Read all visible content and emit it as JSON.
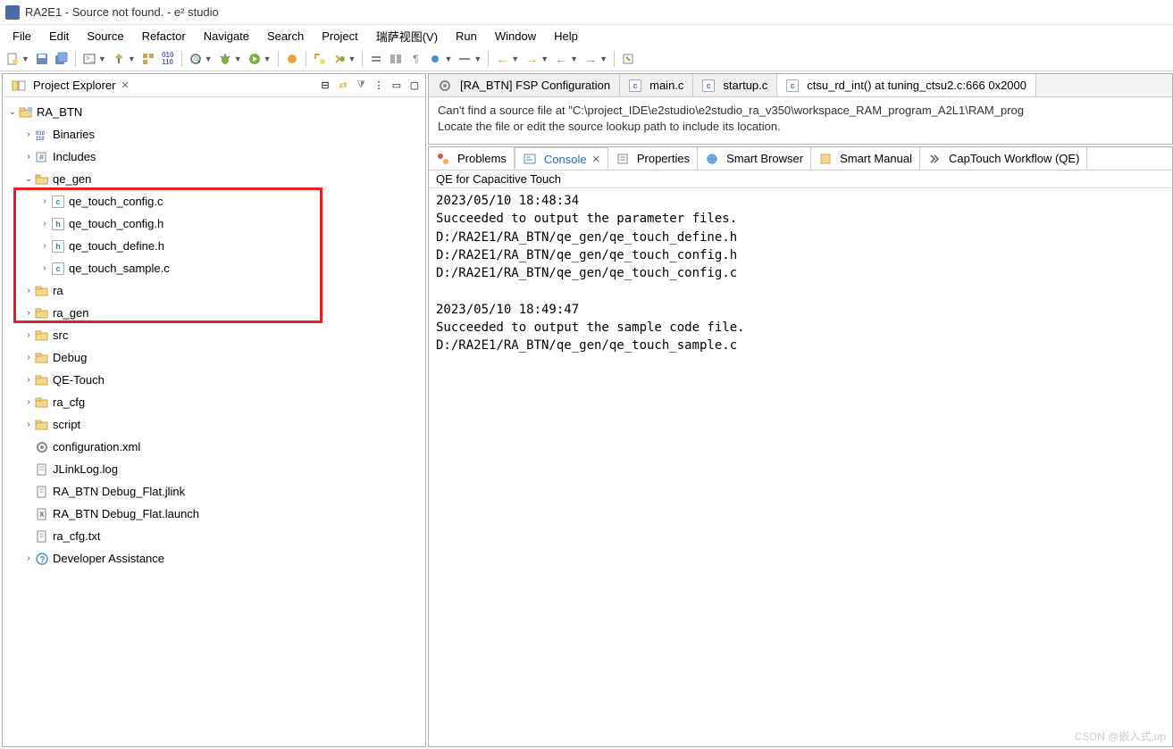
{
  "title": "RA2E1 - Source not found. - e² studio",
  "menu": [
    "File",
    "Edit",
    "Source",
    "Refactor",
    "Navigate",
    "Search",
    "Project",
    "瑞萨视图(V)",
    "Run",
    "Window",
    "Help"
  ],
  "projectExplorer": {
    "title": "Project Explorer",
    "root": {
      "name": "RA_BTN",
      "children": [
        {
          "name": "Binaries",
          "type": "binaries",
          "expanded": false
        },
        {
          "name": "Includes",
          "type": "includes",
          "expanded": false
        },
        {
          "name": "qe_gen",
          "type": "folder-open",
          "expanded": true,
          "highlight": true,
          "children": [
            {
              "name": "qe_touch_config.c",
              "type": "c",
              "expanded": false
            },
            {
              "name": "qe_touch_config.h",
              "type": "h",
              "expanded": false
            },
            {
              "name": "qe_touch_define.h",
              "type": "h",
              "expanded": false
            },
            {
              "name": "qe_touch_sample.c",
              "type": "c",
              "expanded": false
            }
          ]
        },
        {
          "name": "ra",
          "type": "folder",
          "expanded": false
        },
        {
          "name": "ra_gen",
          "type": "folder",
          "expanded": false
        },
        {
          "name": "src",
          "type": "folder",
          "expanded": false
        },
        {
          "name": "Debug",
          "type": "folder",
          "expanded": false
        },
        {
          "name": "QE-Touch",
          "type": "folder",
          "expanded": false
        },
        {
          "name": "ra_cfg",
          "type": "folder",
          "expanded": false
        },
        {
          "name": "script",
          "type": "folder",
          "expanded": false
        },
        {
          "name": "configuration.xml",
          "type": "gear",
          "leaf": true
        },
        {
          "name": "JLinkLog.log",
          "type": "file",
          "leaf": true
        },
        {
          "name": "RA_BTN Debug_Flat.jlink",
          "type": "file",
          "leaf": true
        },
        {
          "name": "RA_BTN Debug_Flat.launch",
          "type": "launch",
          "leaf": true
        },
        {
          "name": "ra_cfg.txt",
          "type": "file",
          "leaf": true
        },
        {
          "name": "Developer Assistance",
          "type": "help",
          "expanded": false
        }
      ]
    }
  },
  "editorTabs": [
    {
      "label": "[RA_BTN] FSP Configuration",
      "icon": "gear",
      "active": false
    },
    {
      "label": "main.c",
      "icon": "c",
      "active": false
    },
    {
      "label": "startup.c",
      "icon": "c",
      "active": false
    },
    {
      "label": "ctsu_rd_int() at tuning_ctsu2.c:666 0x2000",
      "icon": "c",
      "active": true
    }
  ],
  "editorMessage": {
    "line1": "Can't find a source file at \"C:\\project_IDE\\e2studio\\e2studio_ra_v350\\workspace_RAM_program_A2L1\\RAM_prog",
    "line2": "Locate the file or edit the source lookup path to include its location."
  },
  "bottomTabs": [
    {
      "label": "Problems",
      "icon": "problems"
    },
    {
      "label": "Console",
      "icon": "console",
      "active": true
    },
    {
      "label": "Properties",
      "icon": "properties"
    },
    {
      "label": "Smart Browser",
      "icon": "browser"
    },
    {
      "label": "Smart Manual",
      "icon": "manual"
    },
    {
      "label": "CapTouch Workflow (QE)",
      "icon": "workflow"
    }
  ],
  "consoleTitle": "QE for Capacitive Touch",
  "consoleText": "2023/05/10 18:48:34\nSucceeded to output the parameter files.\nD:/RA2E1/RA_BTN/qe_gen/qe_touch_define.h\nD:/RA2E1/RA_BTN/qe_gen/qe_touch_config.h\nD:/RA2E1/RA_BTN/qe_gen/qe_touch_config.c\n\n2023/05/10 18:49:47\nSucceeded to output the sample code file.\nD:/RA2E1/RA_BTN/qe_gen/qe_touch_sample.c",
  "watermark": "CSDN @嵌入式,up"
}
